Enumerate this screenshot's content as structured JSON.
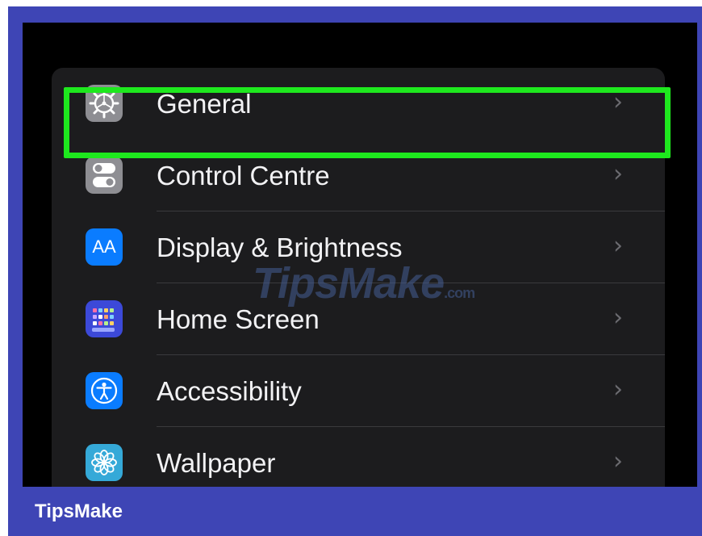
{
  "settings": {
    "items": [
      {
        "label": "General",
        "icon": "gear-icon",
        "chevron": "›",
        "icon_bg": "#8e8e93",
        "highlighted": true
      },
      {
        "label": "Control Centre",
        "icon": "toggle-switches-icon",
        "chevron": "›",
        "icon_bg": "#8e8e93"
      },
      {
        "label": "Display & Brightness",
        "icon": "text-size-icon",
        "icon_text": "AA",
        "chevron": "›",
        "icon_bg": "#0a7cff"
      },
      {
        "label": "Home Screen",
        "icon": "app-grid-icon",
        "chevron": "›",
        "icon_bg": "#3c49d8"
      },
      {
        "label": "Accessibility",
        "icon": "accessibility-person-icon",
        "chevron": "›",
        "icon_bg": "#0a7cff"
      },
      {
        "label": "Wallpaper",
        "icon": "flower-icon",
        "chevron": "›",
        "icon_bg": "#35a9d8"
      }
    ]
  },
  "watermark": {
    "text": "TipsMake",
    "suffix": ".com"
  },
  "footer": {
    "brand": "TipsMake"
  },
  "colors": {
    "frame": "#3e45b5",
    "highlight": "#1ee81e",
    "row_background": "#1c1c1e",
    "text": "#f2f2f4"
  }
}
